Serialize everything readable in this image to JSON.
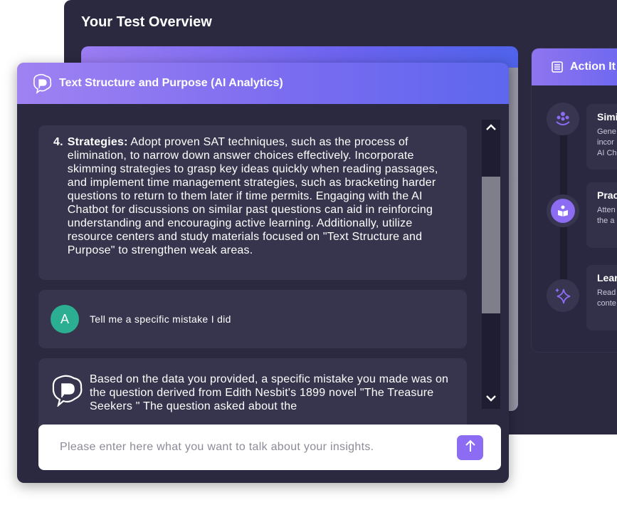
{
  "overview": {
    "title": "Your Test Overview"
  },
  "action_items": {
    "header": "Action It",
    "items": [
      {
        "title": "Simi",
        "desc": [
          "Gene",
          "incor",
          "AI Ch"
        ],
        "icon": "dots-cluster-icon"
      },
      {
        "title": "Prac",
        "desc": [
          "Atten",
          "the a"
        ],
        "icon": "book-icon"
      },
      {
        "title": "Lear",
        "desc": [
          "Read",
          "conte"
        ],
        "icon": "sparkle-icon"
      }
    ]
  },
  "chat": {
    "header": "Text Structure and Purpose (AI Analytics)",
    "strategy": {
      "number": "4.",
      "label": "Strategies:",
      "text": "Adopt proven SAT techniques, such as the process of elimination, to narrow down answer choices effectively. Incorporate skimming strategies to grasp key ideas quickly when reading passages, and implement time management strategies, such as bracketing harder questions to return to them later if time permits. Engaging with the AI Chatbot for discussions on similar past questions can aid in reinforcing understanding and encouraging active learning. Additionally, utilize resource centers and study materials focused on \"Text Structure and Purpose\" to strengthen weak areas."
    },
    "user_message": {
      "avatar": "A",
      "text": "Tell me a specific mistake I did"
    },
    "ai_message": {
      "text": "Based on the data you provided, a specific mistake you made was on the question derived from Edith Nesbit's 1899 novel \"The Treasure Seekers \" The question asked about the"
    },
    "input": {
      "placeholder": "Please enter here what you want to talk about your insights."
    }
  },
  "colors": {
    "accent": "#8b6cf3",
    "panel": "#2b2940",
    "avatar": "#2bae91"
  }
}
